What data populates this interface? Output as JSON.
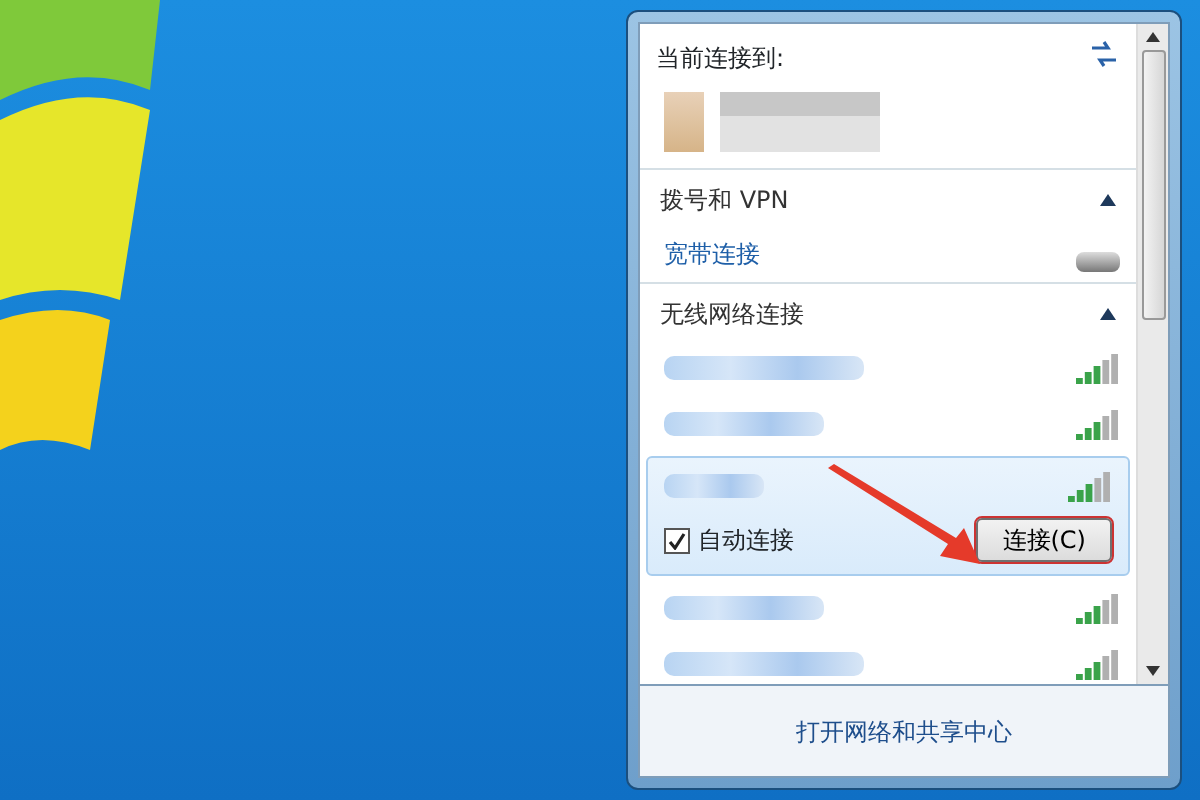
{
  "current": {
    "heading": "当前连接到:"
  },
  "sections": [
    {
      "title": "拨号和 VPN",
      "expanded": true,
      "items": [
        {
          "kind": "dialup",
          "label": "宽带连接"
        }
      ]
    },
    {
      "title": "无线网络连接",
      "expanded": true,
      "items": [
        {
          "kind": "wifi",
          "selected": false
        },
        {
          "kind": "wifi",
          "selected": false
        },
        {
          "kind": "wifi",
          "selected": true,
          "auto_connect": {
            "label": "自动连接",
            "checked": true
          },
          "connect_button": "连接(C)"
        },
        {
          "kind": "wifi",
          "selected": false
        },
        {
          "kind": "wifi",
          "selected": false
        }
      ]
    }
  ],
  "footer_link": "打开网络和共享中心"
}
